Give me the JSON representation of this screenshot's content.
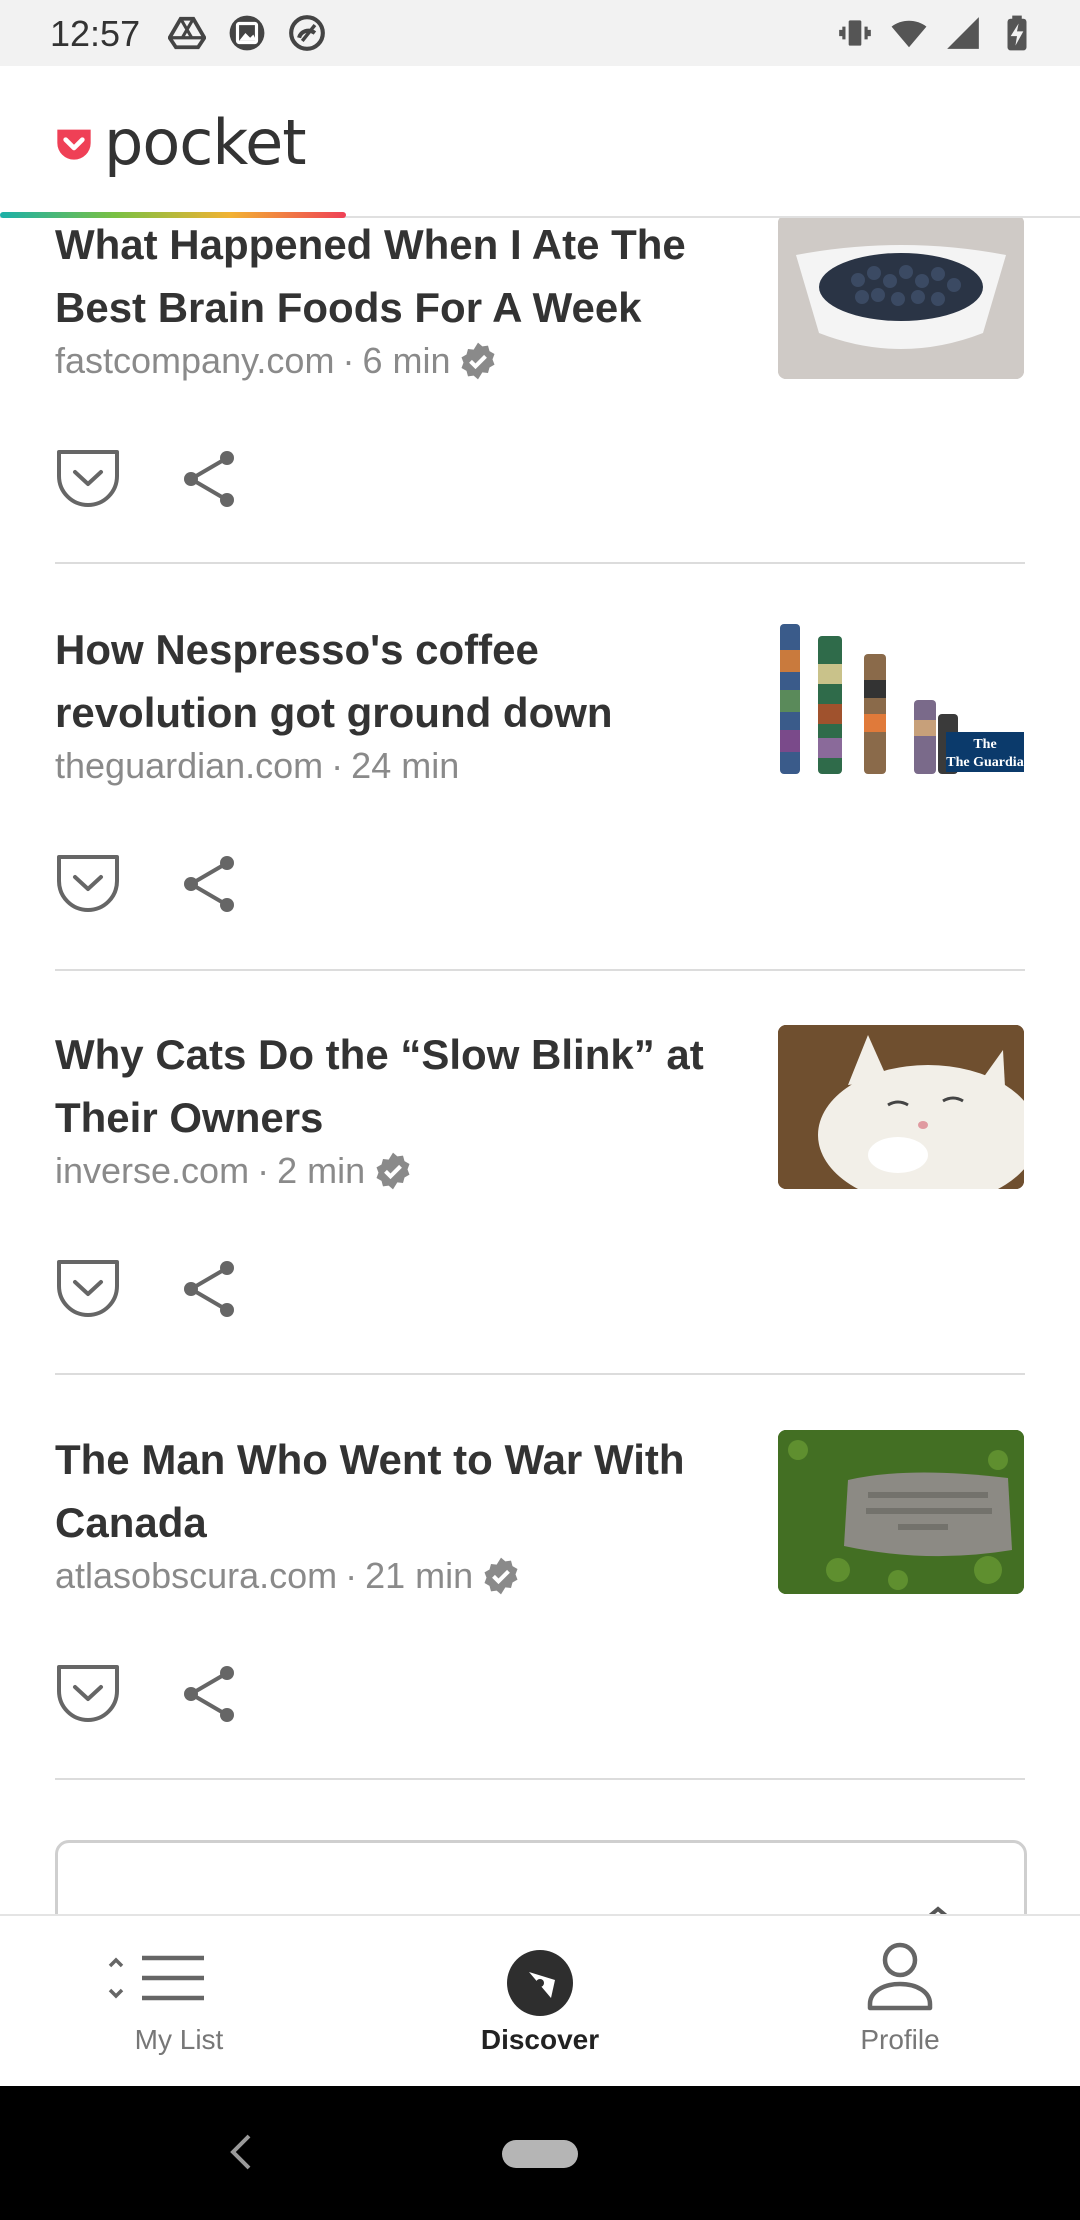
{
  "status_bar": {
    "time": "12:57"
  },
  "app": {
    "name": "pocket"
  },
  "articles": [
    {
      "title": "What Happened When I Ate The Best Brain Foods For A Week",
      "source": "fastcompany.com",
      "read_time": "6 min",
      "verified": true,
      "thumb": "bowl-of-blueberries"
    },
    {
      "title": "How Nespresso's coffee revolution got ground down",
      "source": "theguardian.com",
      "read_time": "24 min",
      "verified": false,
      "thumb": "nespresso-capsule-stacks",
      "thumb_badge": "The Guardia"
    },
    {
      "title": "Why Cats Do the “Slow Blink” at Their Owners",
      "source": "inverse.com",
      "read_time": "2 min",
      "verified": true,
      "thumb": "smiling-white-cat"
    },
    {
      "title": "The Man Who Went to War With Canada",
      "source": "atlasobscura.com",
      "read_time": "21 min",
      "verified": true,
      "thumb": "stone-plaque-in-moss"
    }
  ],
  "meta_separator": "·",
  "bottom_nav": {
    "my_list": "My List",
    "discover": "Discover",
    "profile": "Profile",
    "active": "discover"
  },
  "colors": {
    "brand": "#ef4056",
    "text": "#333333",
    "meta": "#8a8a8a",
    "icon": "#666666"
  }
}
